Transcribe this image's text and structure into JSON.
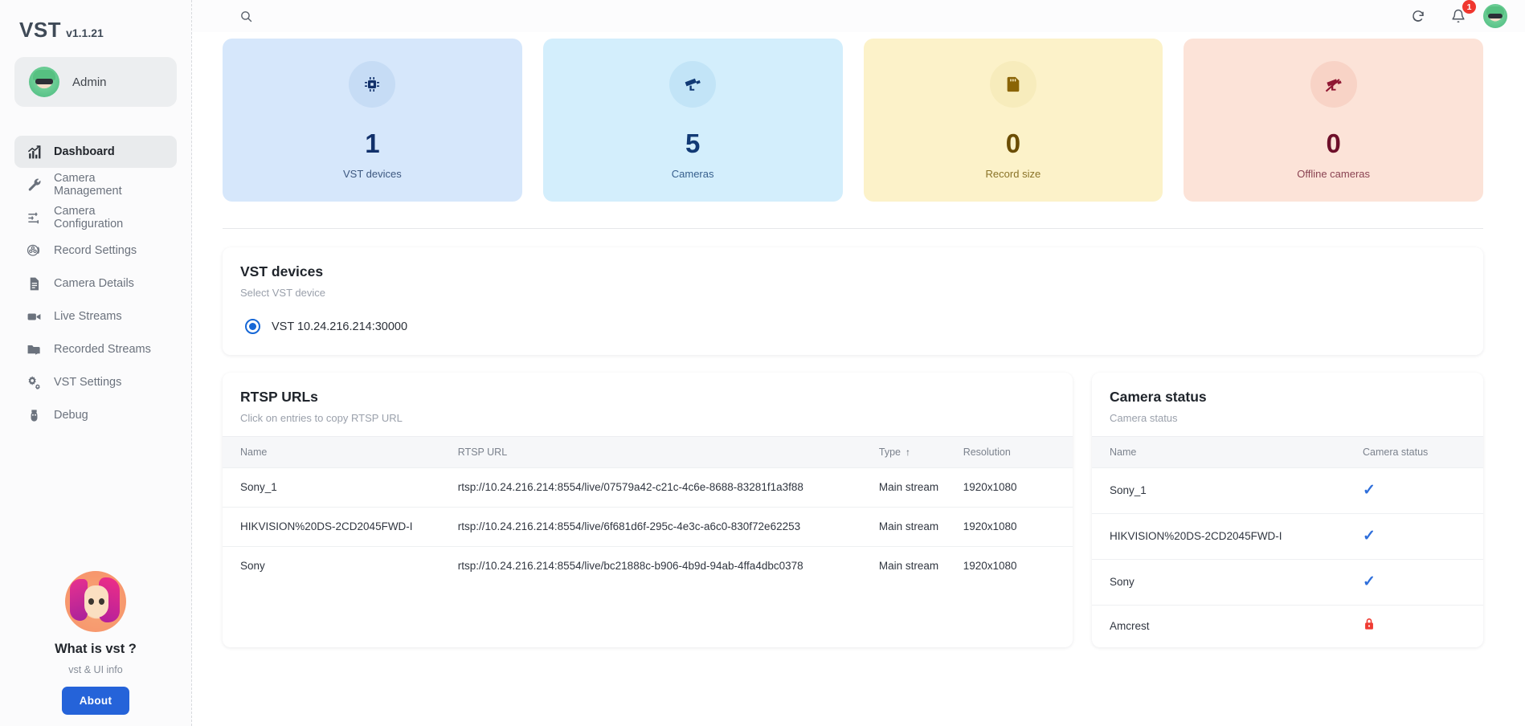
{
  "sidebar": {
    "brand": {
      "name": "VST",
      "version": "v1.1.21"
    },
    "user": {
      "name": "Admin",
      "avatar_icon": "user-avatar-green"
    },
    "items": [
      {
        "label": "Dashboard",
        "icon": "chart-bars-icon",
        "active": true
      },
      {
        "label": "Camera Management",
        "icon": "wrench-icon",
        "active": false
      },
      {
        "label": "Camera Configuration",
        "icon": "sliders-icon",
        "active": false
      },
      {
        "label": "Record Settings",
        "icon": "film-reel-icon",
        "active": false
      },
      {
        "label": "Camera Details",
        "icon": "document-icon",
        "active": false
      },
      {
        "label": "Live Streams",
        "icon": "video-camera-icon",
        "active": false
      },
      {
        "label": "Recorded Streams",
        "icon": "folder-play-icon",
        "active": false
      },
      {
        "label": "VST Settings",
        "icon": "gears-icon",
        "active": false
      },
      {
        "label": "Debug",
        "icon": "bug-icon",
        "active": false
      }
    ],
    "promo": {
      "avatar_icon": "woman-pink-hair-avatar",
      "title": "What is vst ?",
      "subtitle": "vst & UI info",
      "button_label": "About"
    }
  },
  "topbar": {
    "search_icon": "search-icon",
    "refresh_icon": "refresh-icon",
    "notifications_icon": "bell-icon",
    "notifications_count": "1",
    "avatar_icon": "user-avatar-green"
  },
  "stats": [
    {
      "value": "1",
      "label": "VST devices",
      "icon": "cpu-chip-icon",
      "bg": "#d6e7fb",
      "circle": "#c6dcf5",
      "fg": "#12316b"
    },
    {
      "value": "5",
      "label": "Cameras",
      "icon": "security-camera-icon",
      "bg": "#d3eefc",
      "circle": "#c2e4f7",
      "fg": "#123a75"
    },
    {
      "value": "0",
      "label": "Record size",
      "icon": "sd-card-icon",
      "bg": "#fcf2c9",
      "circle": "#f7ecbc",
      "fg": "#8a6406"
    },
    {
      "value": "0",
      "label": "Offline cameras",
      "icon": "camera-off-icon",
      "bg": "#fce3d8",
      "circle": "#f8d3c6",
      "fg": "#8f1733"
    }
  ],
  "vst_devices": {
    "title": "VST devices",
    "subtitle": "Select VST device",
    "options": [
      {
        "label": "VST 10.24.216.214:30000",
        "selected": true
      }
    ]
  },
  "rtsp": {
    "title": "RTSP URLs",
    "subtitle": "Click on entries to copy RTSP URL",
    "columns": [
      "Name",
      "RTSP URL",
      "Type",
      "Resolution"
    ],
    "sorted_column": "Type",
    "sort_arrow": "↑",
    "rows": [
      {
        "name": "Sony_1",
        "url": "rtsp://10.24.216.214:8554/live/07579a42-c21c-4c6e-8688-83281f1a3f88",
        "type": "Main stream",
        "resolution": "1920x1080"
      },
      {
        "name": "HIKVISION%20DS-2CD2045FWD-I",
        "url": "rtsp://10.24.216.214:8554/live/6f681d6f-295c-4e3c-a6c0-830f72e62253",
        "type": "Main stream",
        "resolution": "1920x1080"
      },
      {
        "name": "Sony",
        "url": "rtsp://10.24.216.214:8554/live/bc21888c-b906-4b9d-94ab-4ffa4dbc0378",
        "type": "Main stream",
        "resolution": "1920x1080"
      }
    ]
  },
  "camera_status": {
    "title": "Camera status",
    "subtitle": "Camera status",
    "columns": [
      "Name",
      "Camera status"
    ],
    "rows": [
      {
        "name": "Sony_1",
        "status": "ok",
        "status_icon": "check-icon"
      },
      {
        "name": "HIKVISION%20DS-2CD2045FWD-I",
        "status": "ok",
        "status_icon": "check-icon"
      },
      {
        "name": "Sony",
        "status": "ok",
        "status_icon": "check-icon"
      },
      {
        "name": "Amcrest",
        "status": "locked",
        "status_icon": "lock-icon"
      }
    ]
  },
  "colors": {
    "accent": "#2563d9",
    "check": "#2f6fdb",
    "lock": "#ef3b33",
    "badge": "#f0372f"
  }
}
